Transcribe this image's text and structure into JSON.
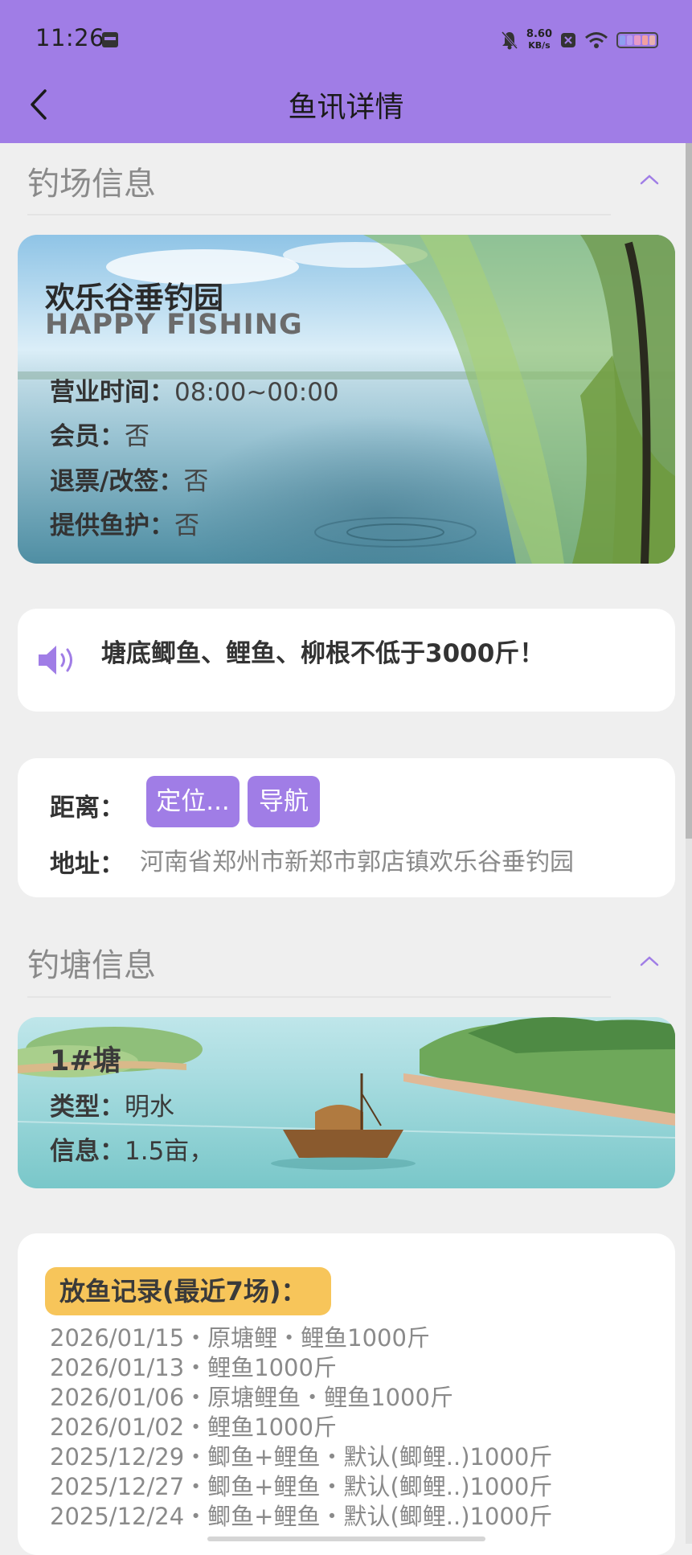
{
  "status_bar": {
    "time": "11:26",
    "net_speed_value": "8.60",
    "net_speed_unit": "KB/s"
  },
  "nav": {
    "title": "鱼讯详情"
  },
  "venue_section": {
    "title": "钓场信息"
  },
  "venue": {
    "name": "欢乐谷垂钓园",
    "name_en": "HAPPY FISHING",
    "hours_label": "营业时间：",
    "hours_value": "08:00~00:00",
    "member_label": "会员：",
    "member_value": "否",
    "refund_label": "退票/改签：",
    "refund_value": "否",
    "care_label": "提供鱼护：",
    "care_value": "否"
  },
  "notice": {
    "text": "塘底鲫鱼、鲤鱼、柳根不低于3000斤！"
  },
  "location": {
    "distance_label": "距离：",
    "locate_button": "定位...",
    "navigate_button": "导航",
    "address_label": "地址：",
    "address_value": "河南省郑州市新郑市郭店镇欢乐谷垂钓园"
  },
  "pond_section": {
    "title": "钓塘信息"
  },
  "pond": {
    "name": "1#塘",
    "type_label": "类型：",
    "type_value": "明水",
    "info_label": "信息：",
    "info_value": "1.5亩，"
  },
  "records": {
    "title": "放鱼记录(最近7场)：",
    "items": [
      "2026/01/15・原塘鲤・鲤鱼1000斤",
      "2026/01/13・鲤鱼1000斤",
      "2026/01/06・原塘鲤鱼・鲤鱼1000斤",
      "2026/01/02・鲤鱼1000斤",
      "2025/12/29・鲫鱼+鲤鱼・默认(鲫鲤..)1000斤",
      "2025/12/27・鲫鱼+鲤鱼・默认(鲫鲤..)1000斤",
      "2025/12/24・鲫鱼+鲤鱼・默认(鲫鲤..)1000斤"
    ]
  },
  "colors": {
    "primary": "#a07de6",
    "background": "#efefef",
    "badge": "#f7c55a",
    "muted_text": "#8a8a8a"
  }
}
